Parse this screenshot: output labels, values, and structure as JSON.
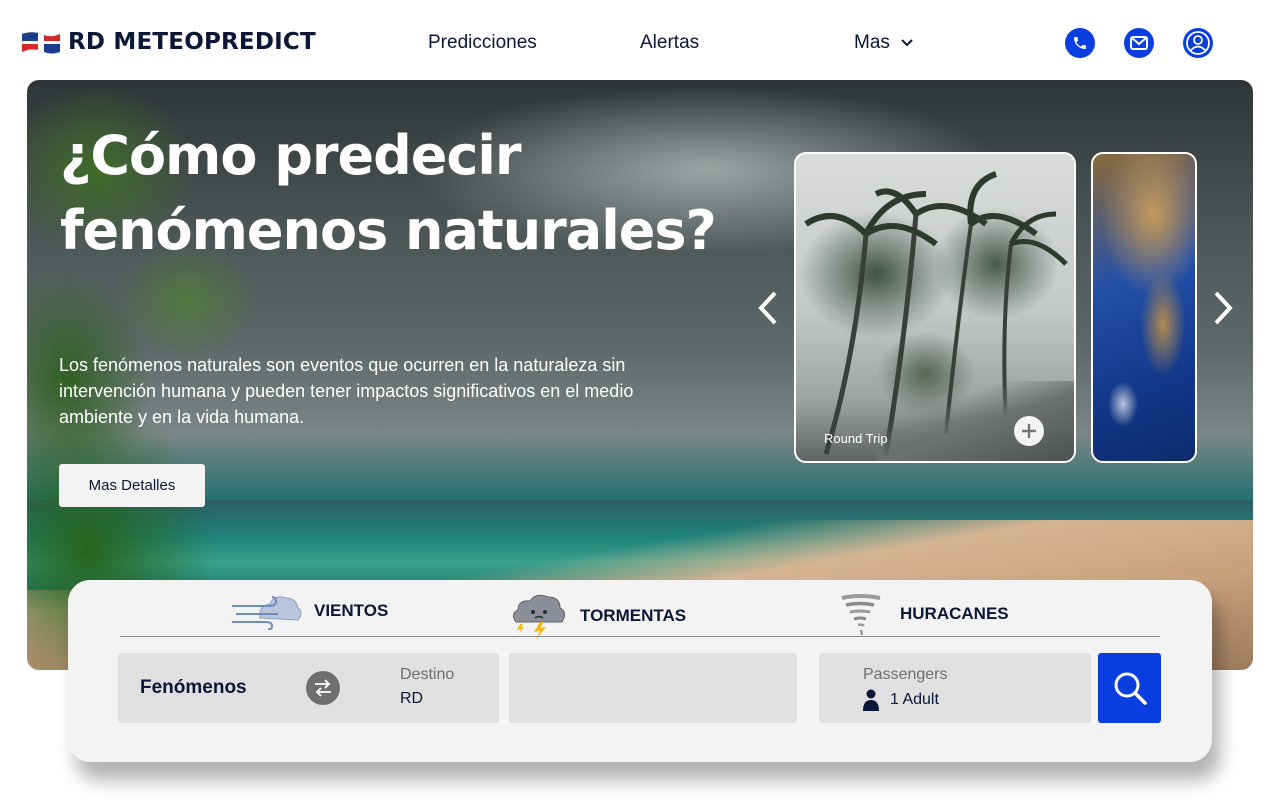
{
  "header": {
    "brand": "RD METEOPREDICT",
    "nav": [
      {
        "label": "Predicciones"
      },
      {
        "label": "Alertas"
      },
      {
        "label": "Mas"
      }
    ],
    "icons": [
      "phone-icon",
      "mail-icon",
      "user-icon"
    ],
    "accent_color": "#0a3ee0"
  },
  "hero": {
    "title": "¿Cómo predecir fenómenos naturales?",
    "description": "Los fenómenos naturales son eventos que ocurren en la naturaleza sin intervención humana y pueden tener impactos significativos en el medio ambiente y en la vida humana.",
    "button_label": "Mas Detalles",
    "carousel": {
      "card_label": "Round Trip"
    }
  },
  "search": {
    "tabs": [
      {
        "label": "VIENTOS",
        "icon": "wind-cloud-icon"
      },
      {
        "label": "TORMENTAS",
        "icon": "storm-cloud-icon"
      },
      {
        "label": "HURACANES",
        "icon": "tornado-icon"
      }
    ],
    "phenomena_label": "Fenómenos",
    "destination_label": "Destino",
    "destination_value": "RD",
    "passengers_label": "Passengers",
    "passengers_value": "1 Adult"
  }
}
